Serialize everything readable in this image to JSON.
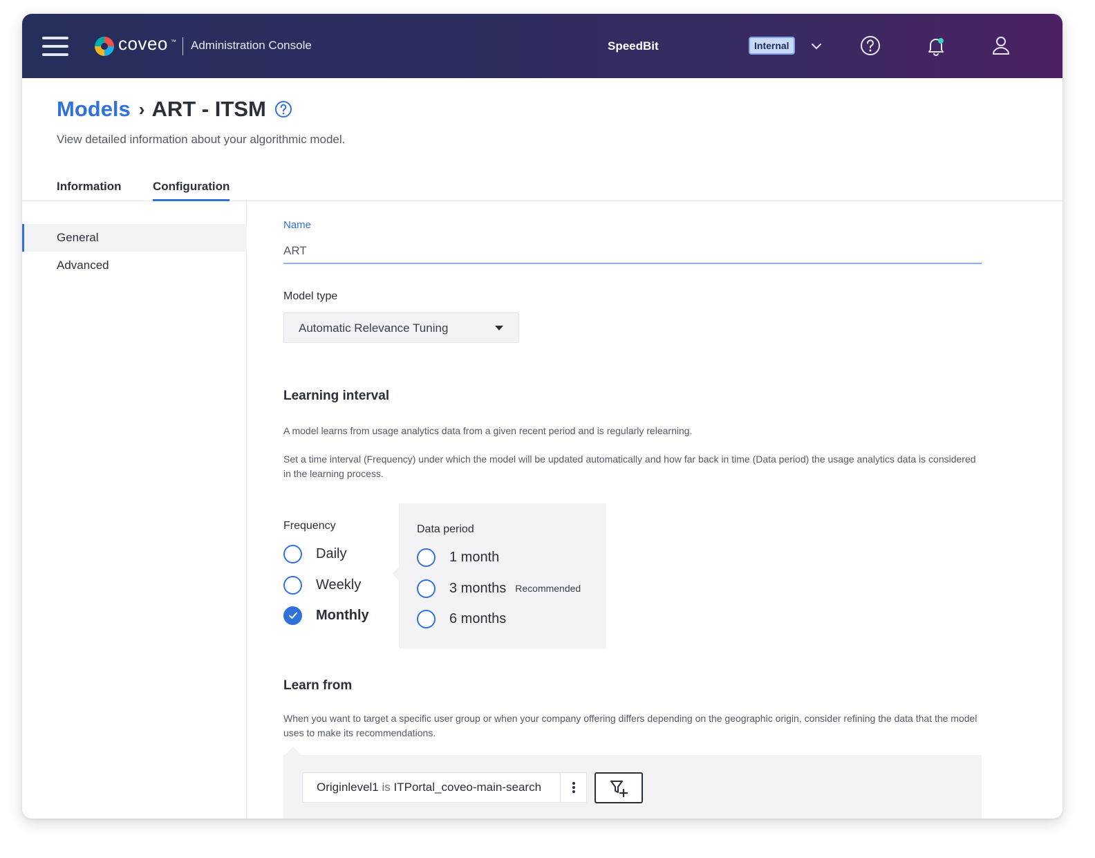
{
  "header": {
    "logo_text": "coveo",
    "logo_tm": "™",
    "console_title": "Administration Console",
    "org_name": "SpeedBit",
    "org_badge": "Internal",
    "icons": [
      "menu-icon",
      "chevron-down-icon",
      "help-icon",
      "bell-icon",
      "user-icon"
    ]
  },
  "page": {
    "breadcrumb_parent": "Models",
    "breadcrumb_sep": "›",
    "breadcrumb_current": "ART - ITSM",
    "description": "View detailed information about your algorithmic model."
  },
  "tabs": [
    {
      "label": "Information",
      "active": false
    },
    {
      "label": "Configuration",
      "active": true
    }
  ],
  "sidebar": {
    "items": [
      {
        "label": "General",
        "active": true
      },
      {
        "label": "Advanced",
        "active": false
      }
    ]
  },
  "form": {
    "name_label": "Name",
    "name_value": "ART",
    "model_type_label": "Model type",
    "model_type_value": "Automatic Relevance Tuning"
  },
  "learning_interval": {
    "title": "Learning interval",
    "para1": "A model learns from usage analytics data from a given recent period and is regularly relearning.",
    "para2": "Set a time interval (Frequency) under which the model will be updated automatically and how far back in time (Data period) the usage analytics data is considered in the learning process.",
    "frequency_label": "Frequency",
    "frequency_options": [
      {
        "label": "Daily",
        "checked": false
      },
      {
        "label": "Weekly",
        "checked": false
      },
      {
        "label": "Monthly",
        "checked": true
      }
    ],
    "data_period_label": "Data period",
    "data_period_options": [
      {
        "label": "1 month",
        "checked": false
      },
      {
        "label": "3 months",
        "checked": false,
        "note": "Recommended"
      },
      {
        "label": "6 months",
        "checked": false
      }
    ]
  },
  "learn_from": {
    "title": "Learn from",
    "para": "When you want to target a specific user group or when your company offering differs depending on the geographic origin, consider refining the data that the model uses to make its recommendations.",
    "filter_field": "Originlevel1",
    "filter_operator": "is",
    "filter_value": "ITPortal_coveo-main-search"
  },
  "colors": {
    "accent": "#2f72d9",
    "header_start": "#262e5c",
    "header_end": "#4b2163",
    "panel_bg": "#f3f3f6",
    "badge_bg": "#c9d9f8"
  }
}
